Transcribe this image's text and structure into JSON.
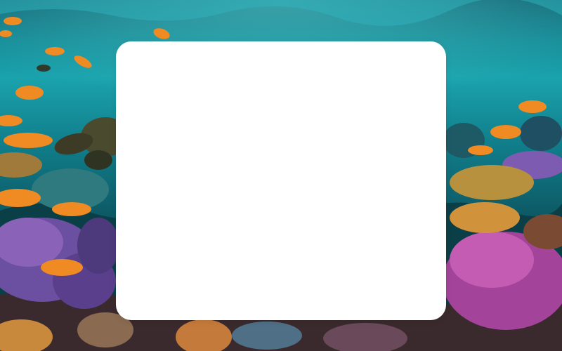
{
  "background": {
    "description_icon": "coral-reef-photo",
    "palette": {
      "water_top": "#138a96",
      "water_mid": "#0d5c68",
      "water_deep": "#07252c",
      "coral_purple": "#7b4fa8",
      "coral_magenta": "#b0479c",
      "coral_orange": "#d98a3a",
      "fish_orange": "#f08a22"
    }
  },
  "card": {
    "background": "#ffffff"
  }
}
